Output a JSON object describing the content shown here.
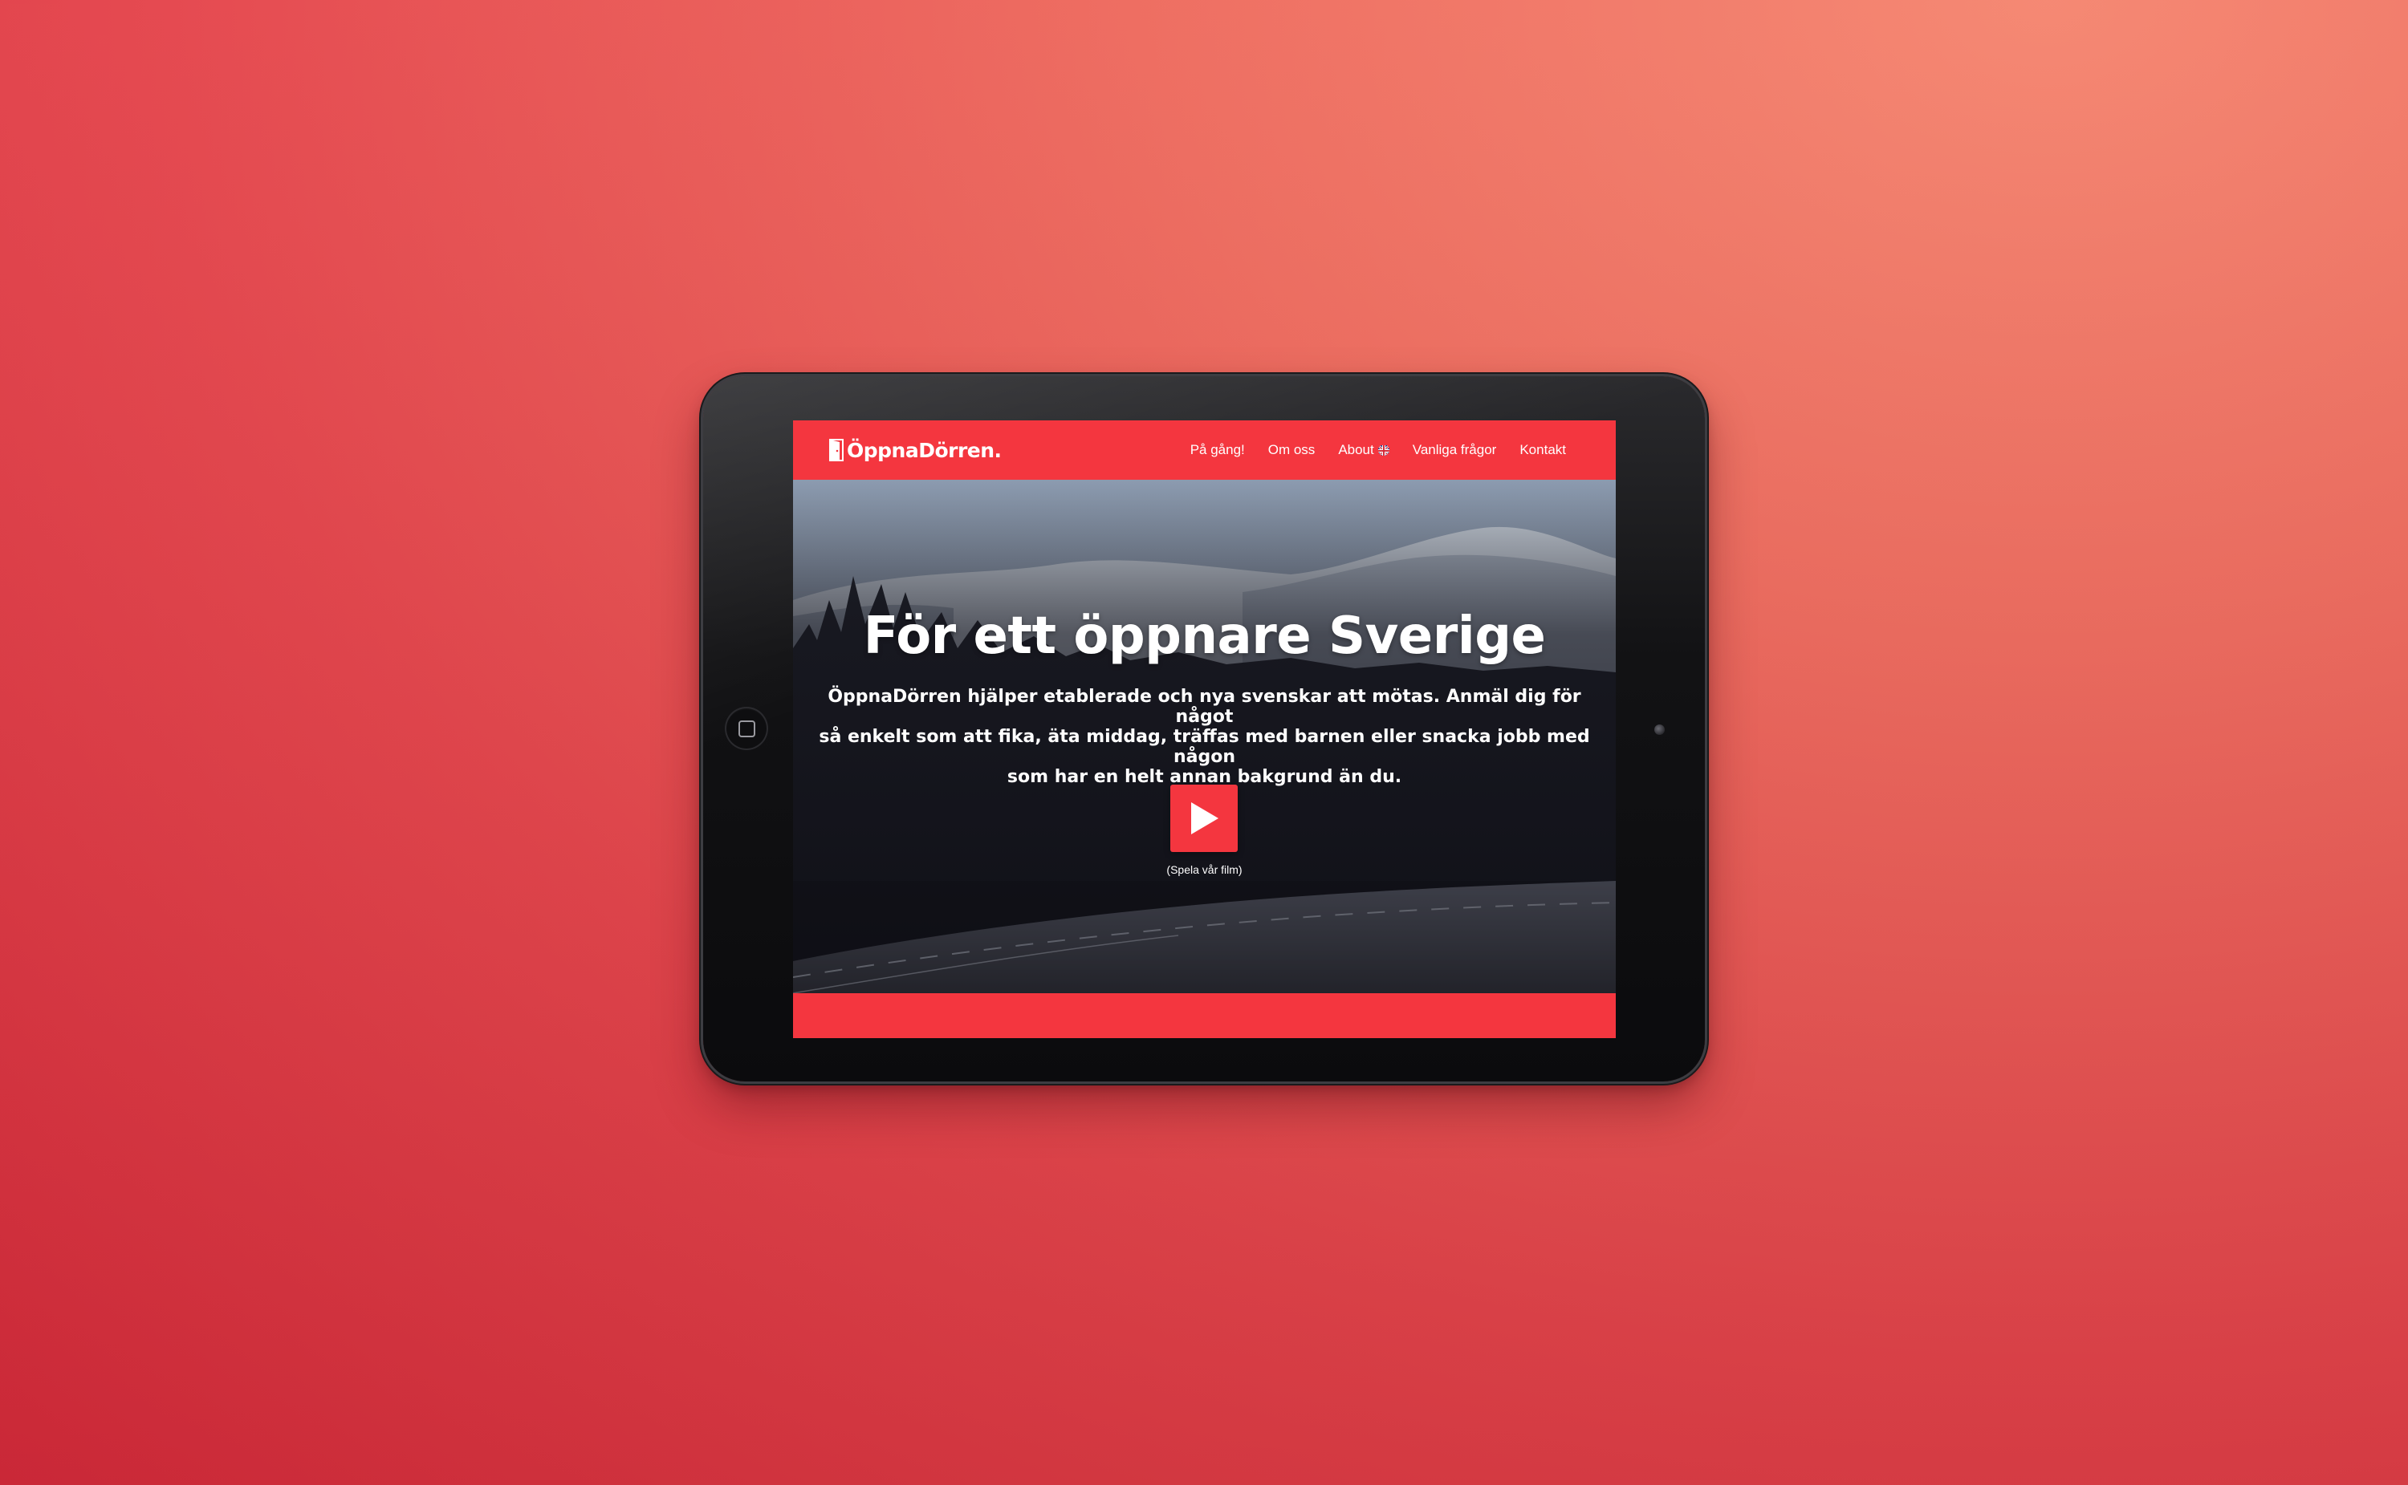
{
  "site": {
    "logo_text": "ÖppnaDörren.",
    "brand_color": "#f4363f"
  },
  "nav": {
    "items": [
      {
        "label": "På gång!"
      },
      {
        "label": "Om oss"
      },
      {
        "label": "About",
        "icon": "uk-flag-icon"
      },
      {
        "label": "Vanliga frågor"
      },
      {
        "label": "Kontakt"
      }
    ]
  },
  "hero": {
    "title": "För ett öppnare Sverige",
    "text_lines": [
      "ÖppnaDörren hjälper etablerade och nya svenskar att mötas. Anmäl dig för något",
      "så enkelt som att fika, äta middag, träffas med barnen eller snacka jobb med någon",
      "som har en helt annan bakgrund än du."
    ],
    "play_icon": "play-icon",
    "play_caption": "(Spela vår film)"
  }
}
